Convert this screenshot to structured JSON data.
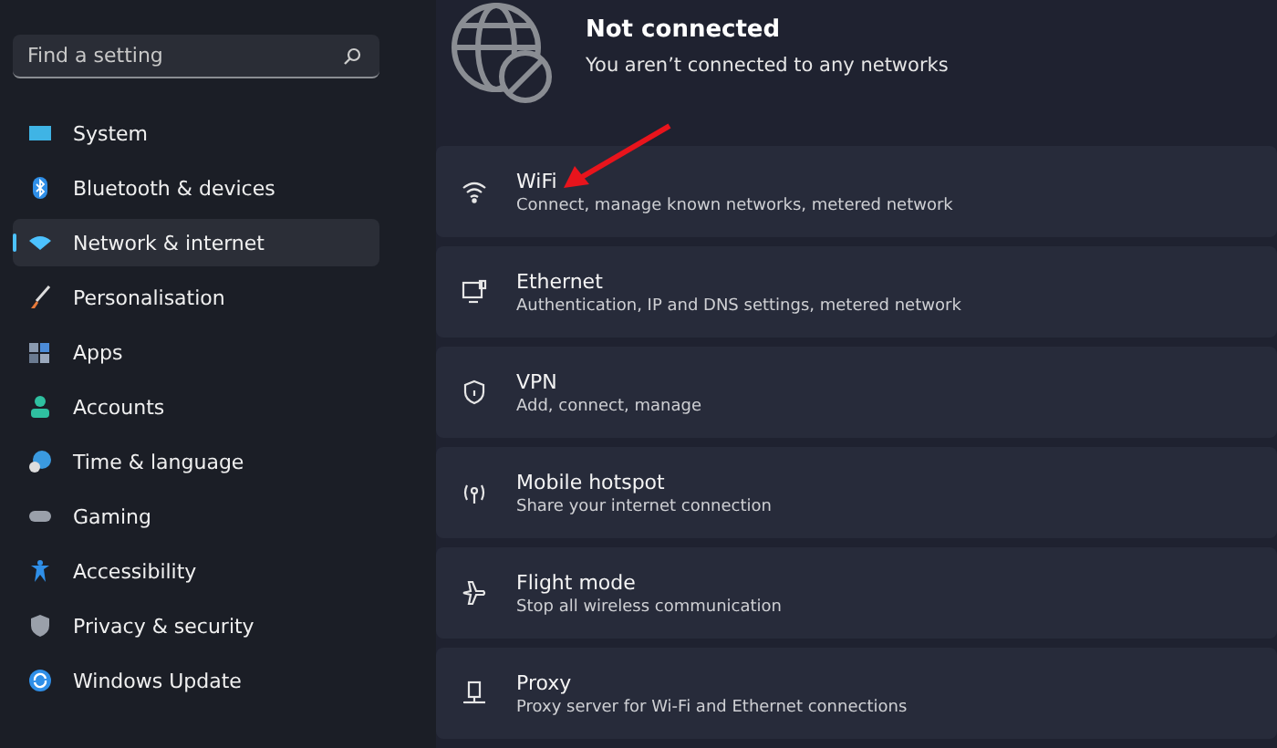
{
  "sidebar": {
    "search": {
      "placeholder": "Find a setting"
    },
    "items": [
      {
        "label": "System",
        "selected": false
      },
      {
        "label": "Bluetooth & devices",
        "selected": false
      },
      {
        "label": "Network & internet",
        "selected": true
      },
      {
        "label": "Personalisation",
        "selected": false
      },
      {
        "label": "Apps",
        "selected": false
      },
      {
        "label": "Accounts",
        "selected": false
      },
      {
        "label": "Time & language",
        "selected": false
      },
      {
        "label": "Gaming",
        "selected": false
      },
      {
        "label": "Accessibility",
        "selected": false
      },
      {
        "label": "Privacy & security",
        "selected": false
      },
      {
        "label": "Windows Update",
        "selected": false
      }
    ]
  },
  "status": {
    "title": "Not connected",
    "subtitle": "You aren’t connected to any networks"
  },
  "settings": [
    {
      "title": "WiFi",
      "subtitle": "Connect, manage known networks, metered network"
    },
    {
      "title": "Ethernet",
      "subtitle": "Authentication, IP and DNS settings, metered network"
    },
    {
      "title": "VPN",
      "subtitle": "Add, connect, manage"
    },
    {
      "title": "Mobile hotspot",
      "subtitle": "Share your internet connection"
    },
    {
      "title": "Flight mode",
      "subtitle": "Stop all wireless communication"
    },
    {
      "title": "Proxy",
      "subtitle": "Proxy server for Wi-Fi and Ethernet connections"
    }
  ]
}
